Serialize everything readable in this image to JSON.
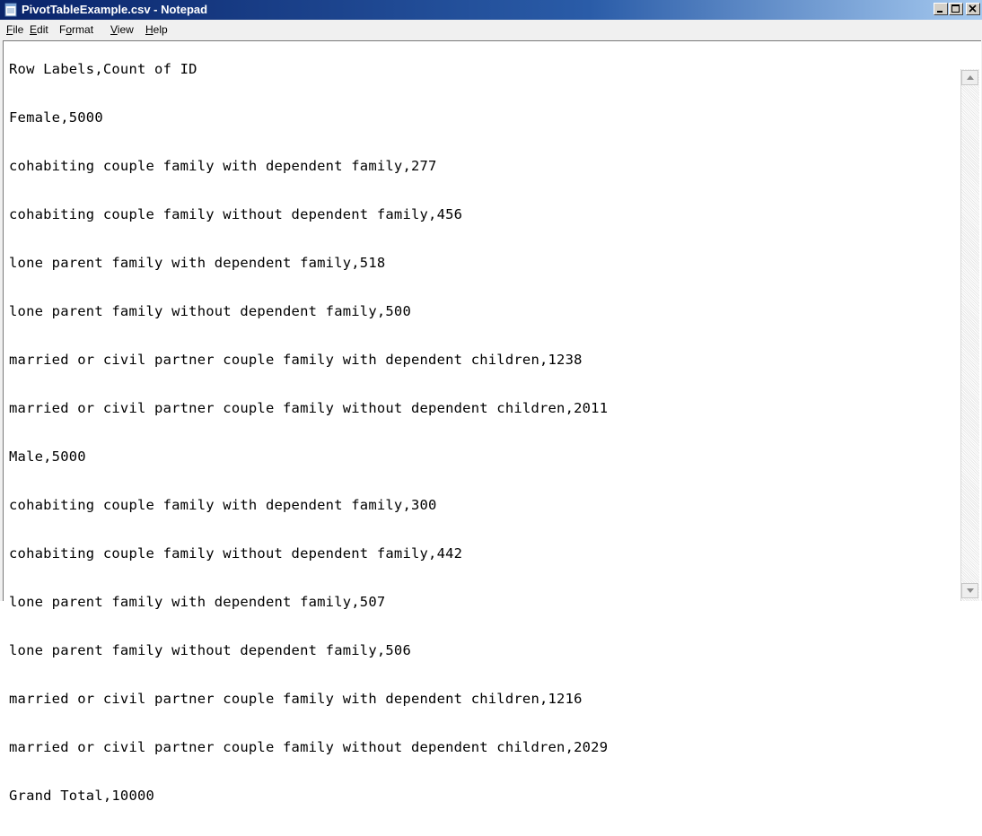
{
  "window": {
    "title": "PivotTableExample.csv - Notepad",
    "icon": "notepad-icon",
    "controls": {
      "minimize": "minimize-icon",
      "maximize": "maximize-icon",
      "close": "close-icon"
    }
  },
  "menu": [
    {
      "mnemonic": "F",
      "rest": "ile"
    },
    {
      "mnemonic": "E",
      "rest": "dit"
    },
    {
      "pre": "F",
      "mnemonic": "o",
      "rest": "rmat"
    },
    {
      "mnemonic": "V",
      "rest": "iew"
    },
    {
      "mnemonic": "H",
      "rest": "elp"
    }
  ],
  "document": {
    "lines": [
      "Row Labels,Count of ID",
      "Female,5000",
      "cohabiting couple family with dependent family,277",
      "cohabiting couple family without dependent family,456",
      "lone parent family with dependent family,518",
      "lone parent family without dependent family,500",
      "married or civil partner couple family with dependent children,1238",
      "married or civil partner couple family without dependent children,2011",
      "Male,5000",
      "cohabiting couple family with dependent family,300",
      "cohabiting couple family without dependent family,442",
      "lone parent family with dependent family,507",
      "lone parent family without dependent family,506",
      "married or civil partner couple family with dependent children,1216",
      "married or civil partner couple family without dependent children,2029",
      "Grand Total,10000"
    ]
  }
}
